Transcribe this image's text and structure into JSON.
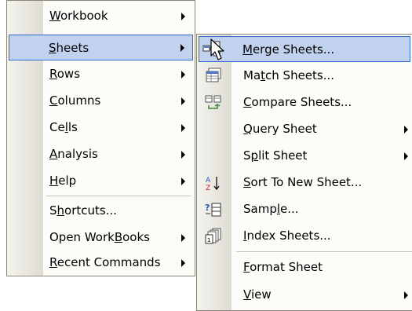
{
  "main_menu": {
    "items": [
      {
        "pre": "",
        "acc": "W",
        "post": "orkbook",
        "submenu": true
      },
      {
        "pre": "",
        "acc": "S",
        "post": "heets",
        "submenu": true
      },
      {
        "pre": "",
        "acc": "R",
        "post": "ows",
        "submenu": true
      },
      {
        "pre": "",
        "acc": "C",
        "post": "olumns",
        "submenu": true
      },
      {
        "pre": "Ce",
        "acc": "l",
        "post": "ls",
        "submenu": true
      },
      {
        "pre": "",
        "acc": "A",
        "post": "nalysis",
        "submenu": true
      },
      {
        "pre": "",
        "acc": "H",
        "post": "elp",
        "submenu": true
      },
      {
        "pre": "S",
        "acc": "h",
        "post": "ortcuts...",
        "submenu": false
      },
      {
        "pre": "Open Work",
        "acc": "B",
        "post": "ooks",
        "submenu": true
      },
      {
        "pre": "",
        "acc": "R",
        "post": "ecent Commands",
        "submenu": true
      }
    ]
  },
  "sheets_submenu": {
    "items": [
      {
        "pre": "",
        "acc": "M",
        "post": "erge Sheets...",
        "submenu": false,
        "icon": "merge-sheets-icon"
      },
      {
        "pre": "Ma",
        "acc": "t",
        "post": "ch Sheets...",
        "submenu": false,
        "icon": "match-sheets-icon"
      },
      {
        "pre": "",
        "acc": "C",
        "post": "ompare Sheets...",
        "submenu": false,
        "icon": "compare-sheets-icon"
      },
      {
        "pre": "",
        "acc": "Q",
        "post": "uery Sheet",
        "submenu": true,
        "icon": ""
      },
      {
        "pre": "S",
        "acc": "p",
        "post": "lit Sheet",
        "submenu": true,
        "icon": ""
      },
      {
        "pre": "",
        "acc": "S",
        "post": "ort To New Sheet...",
        "submenu": false,
        "icon": "sort-az-icon"
      },
      {
        "pre": "Samp",
        "acc": "l",
        "post": "e...",
        "submenu": false,
        "icon": "sample-icon"
      },
      {
        "pre": "",
        "acc": "I",
        "post": "ndex Sheets...",
        "submenu": false,
        "icon": "index-sheets-icon"
      },
      {
        "pre": "",
        "acc": "F",
        "post": "ormat Sheet",
        "submenu": false,
        "icon": ""
      },
      {
        "pre": "",
        "acc": "V",
        "post": "iew",
        "submenu": true,
        "icon": ""
      }
    ]
  },
  "colors": {
    "highlight_bg": "#c1d2ee",
    "highlight_border": "#316ac5",
    "menu_bg": "#fcfcf9"
  }
}
